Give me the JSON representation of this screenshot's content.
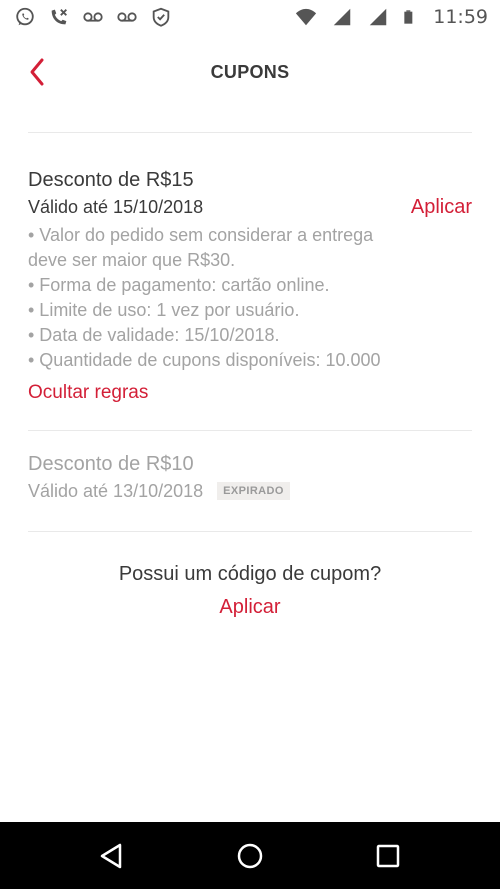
{
  "status_bar": {
    "time": "11:59",
    "icons_left": [
      "whatsapp-icon",
      "missed-call-icon",
      "voicemail-icon",
      "voicemail-icon",
      "shield-check-icon"
    ],
    "icons_right": [
      "wifi-icon",
      "signal-icon",
      "signal-icon",
      "battery-icon"
    ]
  },
  "header": {
    "title": "CUPONS",
    "back_icon": "chevron-left-icon"
  },
  "coupons": [
    {
      "title": "Desconto de R$15",
      "valid": "Válido até 15/10/2018",
      "action": "Aplicar",
      "rules": [
        "• Valor do pedido sem considerar a entrega",
        "deve ser maior que R$30.",
        "• Forma de pagamento: cartão online.",
        "• Limite de uso: 1 vez por usuário.",
        "• Data de validade: 15/10/2018.",
        "• Quantidade de cupons disponíveis: 10.000"
      ],
      "toggle_rules": "Ocultar regras"
    },
    {
      "title": "Desconto de R$10",
      "valid": "Válido até 13/10/2018",
      "badge": "EXPIRADO"
    }
  ],
  "code_prompt": {
    "question": "Possui um código de cupom?",
    "action": "Aplicar"
  },
  "nav_bar": {
    "back": "back-triangle-icon",
    "home": "home-circle-icon",
    "recents": "recents-square-icon"
  },
  "colors": {
    "accent": "#d31f37",
    "text": "#3a3a3a",
    "muted": "#a3a3a3",
    "divider": "#e9e9e9"
  }
}
